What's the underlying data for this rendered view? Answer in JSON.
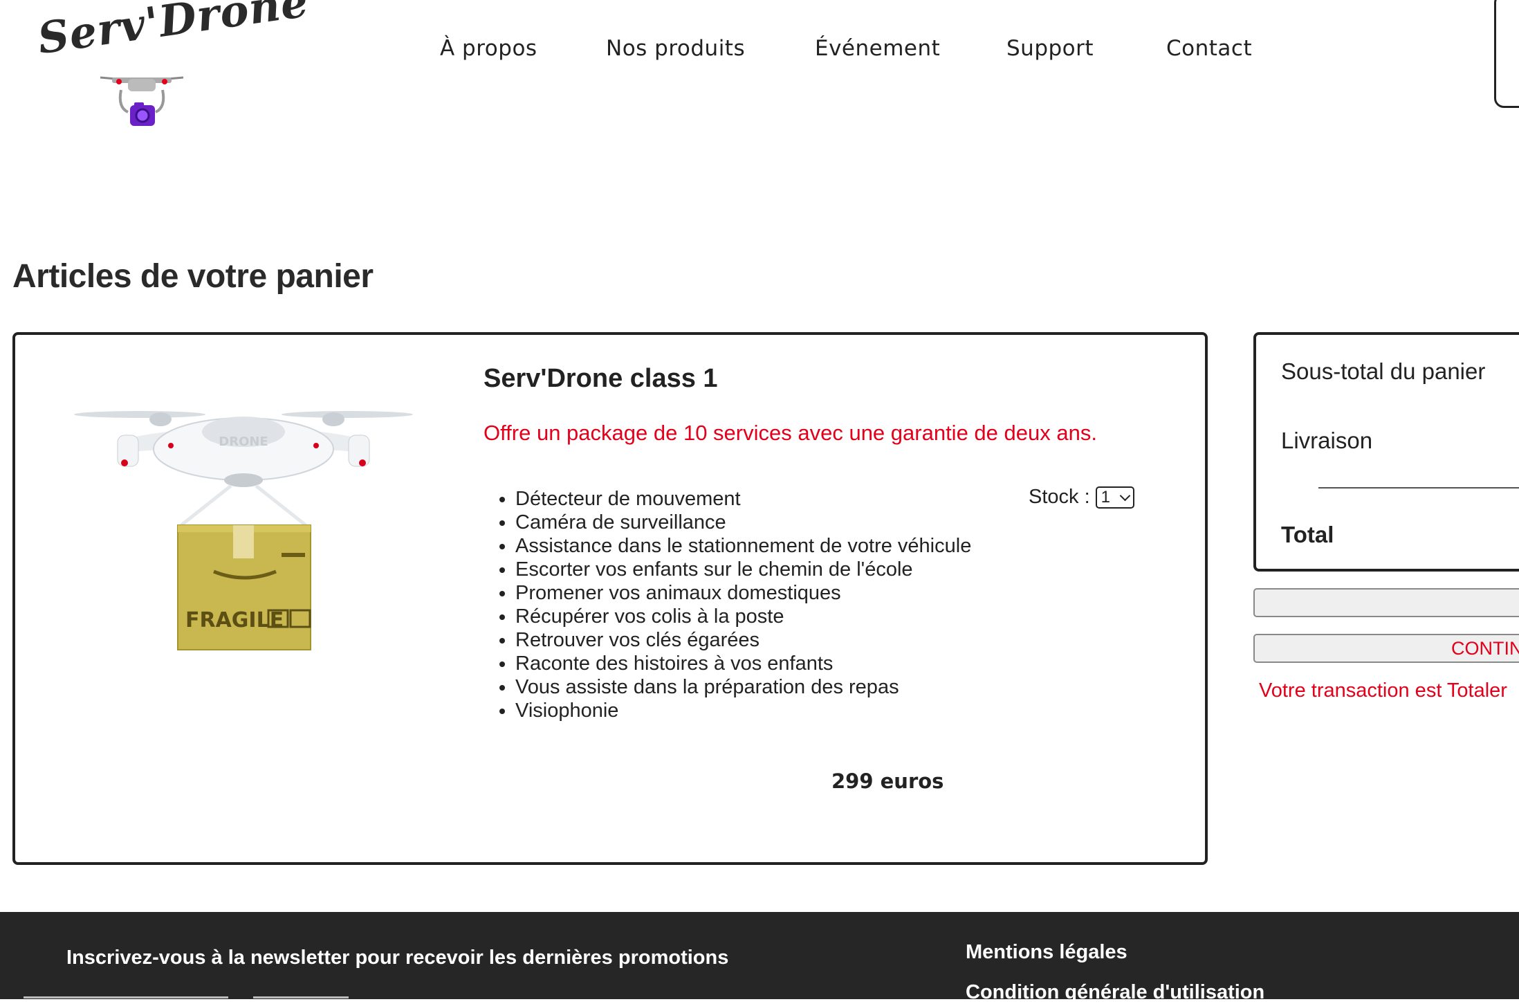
{
  "header": {
    "logo_text": "Serv'Drone",
    "nav": [
      {
        "label": "À propos"
      },
      {
        "label": "Nos produits"
      },
      {
        "label": "Événement"
      },
      {
        "label": "Support"
      },
      {
        "label": "Contact"
      }
    ]
  },
  "main": {
    "title": "Articles de votre panier"
  },
  "product": {
    "name": "Serv'Drone class 1",
    "offer": "Offre un package de 10 services avec une garantie de deux ans.",
    "features": [
      "Détecteur de mouvement",
      "Caméra de surveillance",
      "Assistance dans le stationnement de votre véhicule",
      "Escorter vos enfants sur le chemin de l'école",
      "Promener vos animaux domestiques",
      "Récupérer vos colis à la poste",
      "Retrouver vos clés égarées",
      "Raconte des histoires à vos enfants",
      "Vous assiste dans la préparation des repas",
      "Visiophonie"
    ],
    "stock_label": "Stock :",
    "stock_value": "1",
    "price": "299 euros",
    "image_box_label": "FRAGILE",
    "image_drone_label": "DRONE"
  },
  "summary": {
    "subtotal_label": "Sous-total du panier",
    "shipping_label": "Livraison",
    "total_label": "Total",
    "continue_label": "CONTIN",
    "secure_message": "Votre transaction est Totaler"
  },
  "footer": {
    "newsletter": "Inscrivez-vous à la newsletter pour recevoir les dernières promotions",
    "links": [
      "Mentions légales",
      "Condition générale d'utilisation"
    ]
  },
  "colors": {
    "accent_red": "#e3001b",
    "footer_bg": "#262626",
    "text": "#222222"
  }
}
